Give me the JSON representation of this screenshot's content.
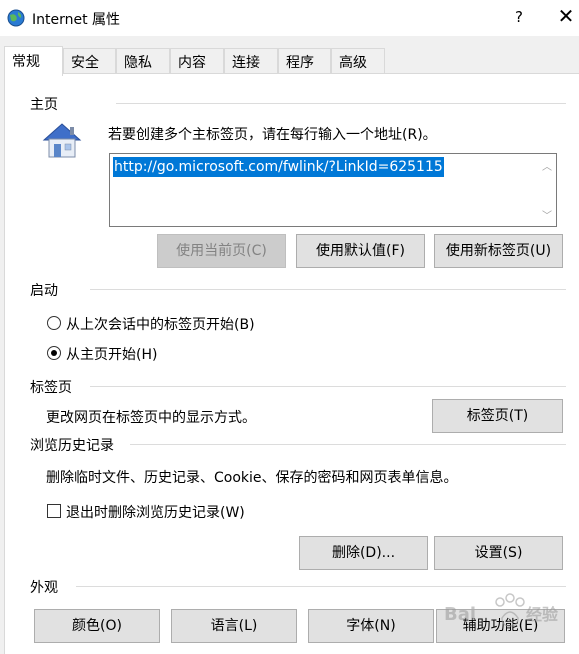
{
  "window": {
    "title": "Internet 属性",
    "help_label": "?",
    "close_label": "✕"
  },
  "tabs": [
    {
      "label": "常规",
      "active": true
    },
    {
      "label": "安全"
    },
    {
      "label": "隐私"
    },
    {
      "label": "内容"
    },
    {
      "label": "连接"
    },
    {
      "label": "程序"
    },
    {
      "label": "高级"
    }
  ],
  "home": {
    "section": "主页",
    "instruction": "若要创建多个主标签页，请在每行输入一个地址(R)。",
    "url": "http://go.microsoft.com/fwlink/?LinkId=625115",
    "buttons": {
      "use_current": "使用当前页(C)",
      "use_default": "使用默认值(F)",
      "use_new_tab": "使用新标签页(U)"
    }
  },
  "startup": {
    "section": "启动",
    "options": [
      {
        "label": "从上次会话中的标签页开始(B)",
        "checked": false
      },
      {
        "label": "从主页开始(H)",
        "checked": true
      }
    ]
  },
  "tabs_section": {
    "section": "标签页",
    "description": "更改网页在标签页中的显示方式。",
    "button": "标签页(T)"
  },
  "history": {
    "section": "浏览历史记录",
    "description": "删除临时文件、历史记录、Cookie、保存的密码和网页表单信息。",
    "checkbox_label": "退出时删除浏览历史记录(W)",
    "checkbox_checked": false,
    "delete_button": "删除(D)...",
    "settings_button": "设置(S)"
  },
  "appearance": {
    "section": "外观",
    "buttons": {
      "colors": "颜色(O)",
      "languages": "语言(L)",
      "fonts": "字体(N)",
      "accessibility": "辅助功能(E)"
    }
  },
  "watermark_text": "Bai 经验",
  "colors": {
    "selection": "#0078d7",
    "panel_bg": "#ffffff",
    "window_bg": "#f0f0f0",
    "button_bg": "#e1e1e1"
  }
}
